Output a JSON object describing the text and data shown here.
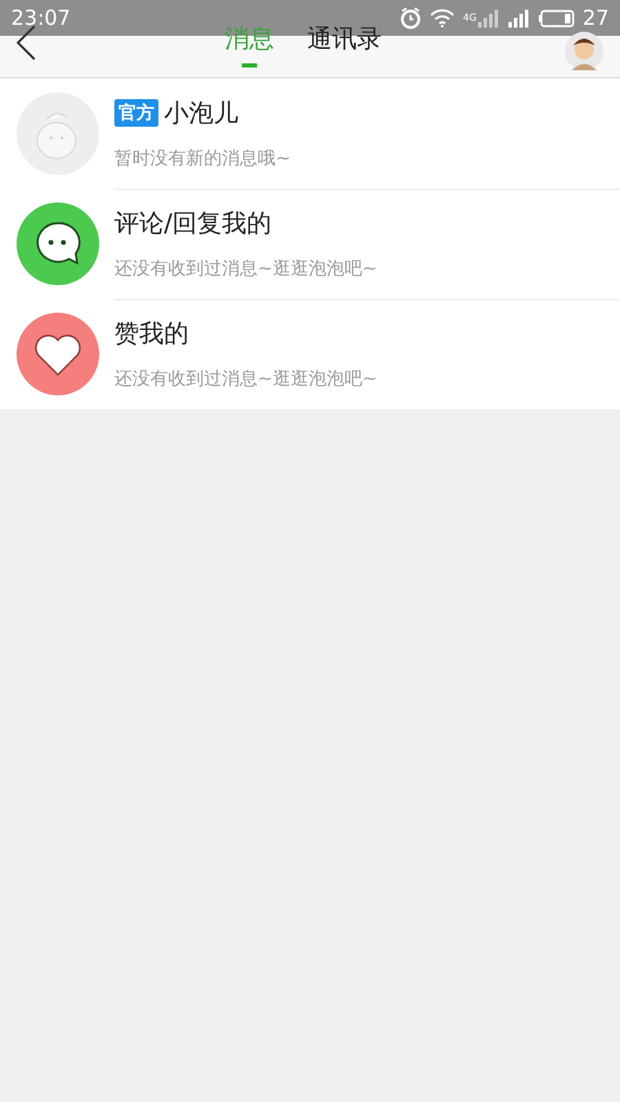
{
  "status_bar": {
    "time": "23:07",
    "network": "4G",
    "battery": "27"
  },
  "tabs": [
    {
      "label": "消息",
      "selected": true
    },
    {
      "label": "通讯录",
      "selected": false
    }
  ],
  "messages": [
    {
      "kind": "official",
      "badge": "官方",
      "title": "小泡儿",
      "preview": "暂时没有新的消息哦~"
    },
    {
      "kind": "comment",
      "title": "评论/回复我的",
      "preview": "还没有收到过消息~逛逛泡泡吧~"
    },
    {
      "kind": "like",
      "title": "赞我的",
      "preview": "还没有收到过消息~逛逛泡泡吧~"
    }
  ]
}
